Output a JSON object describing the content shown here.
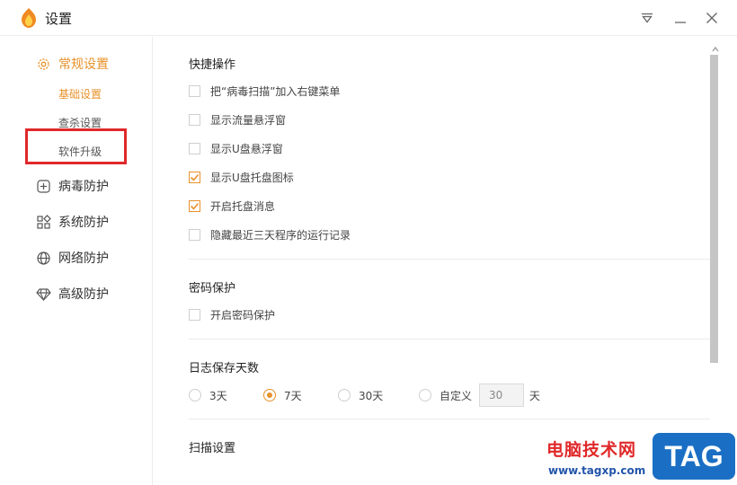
{
  "window": {
    "title": "设置"
  },
  "sidebar": {
    "general": {
      "label": "常规设置",
      "sub": [
        "基础设置",
        "查杀设置",
        "软件升级"
      ]
    },
    "items": [
      "病毒防护",
      "系统防护",
      "网络防护",
      "高级防护"
    ]
  },
  "sections": {
    "quick_ops": {
      "title": "快捷操作",
      "options": [
        {
          "label": "把“病毒扫描”加入右键菜单",
          "checked": false
        },
        {
          "label": "显示流量悬浮窗",
          "checked": false
        },
        {
          "label": "显示U盘悬浮窗",
          "checked": false
        },
        {
          "label": "显示U盘托盘图标",
          "checked": true
        },
        {
          "label": "开启托盘消息",
          "checked": true
        },
        {
          "label": "隐藏最近三天程序的运行记录",
          "checked": false
        }
      ]
    },
    "password": {
      "title": "密码保护",
      "option": {
        "label": "开启密码保护",
        "checked": false
      }
    },
    "log_days": {
      "title": "日志保存天数",
      "options": [
        "3天",
        "7天",
        "30天",
        "自定义"
      ],
      "selected": "7天",
      "custom_value": "30",
      "custom_unit": "天"
    },
    "scan": {
      "title": "扫描设置"
    }
  },
  "watermark": {
    "text": "电脑技术网",
    "url": "www.tagxp.com",
    "tag": "TAG"
  },
  "colors": {
    "accent": "#e8912b",
    "highlight": "#e0282a"
  }
}
